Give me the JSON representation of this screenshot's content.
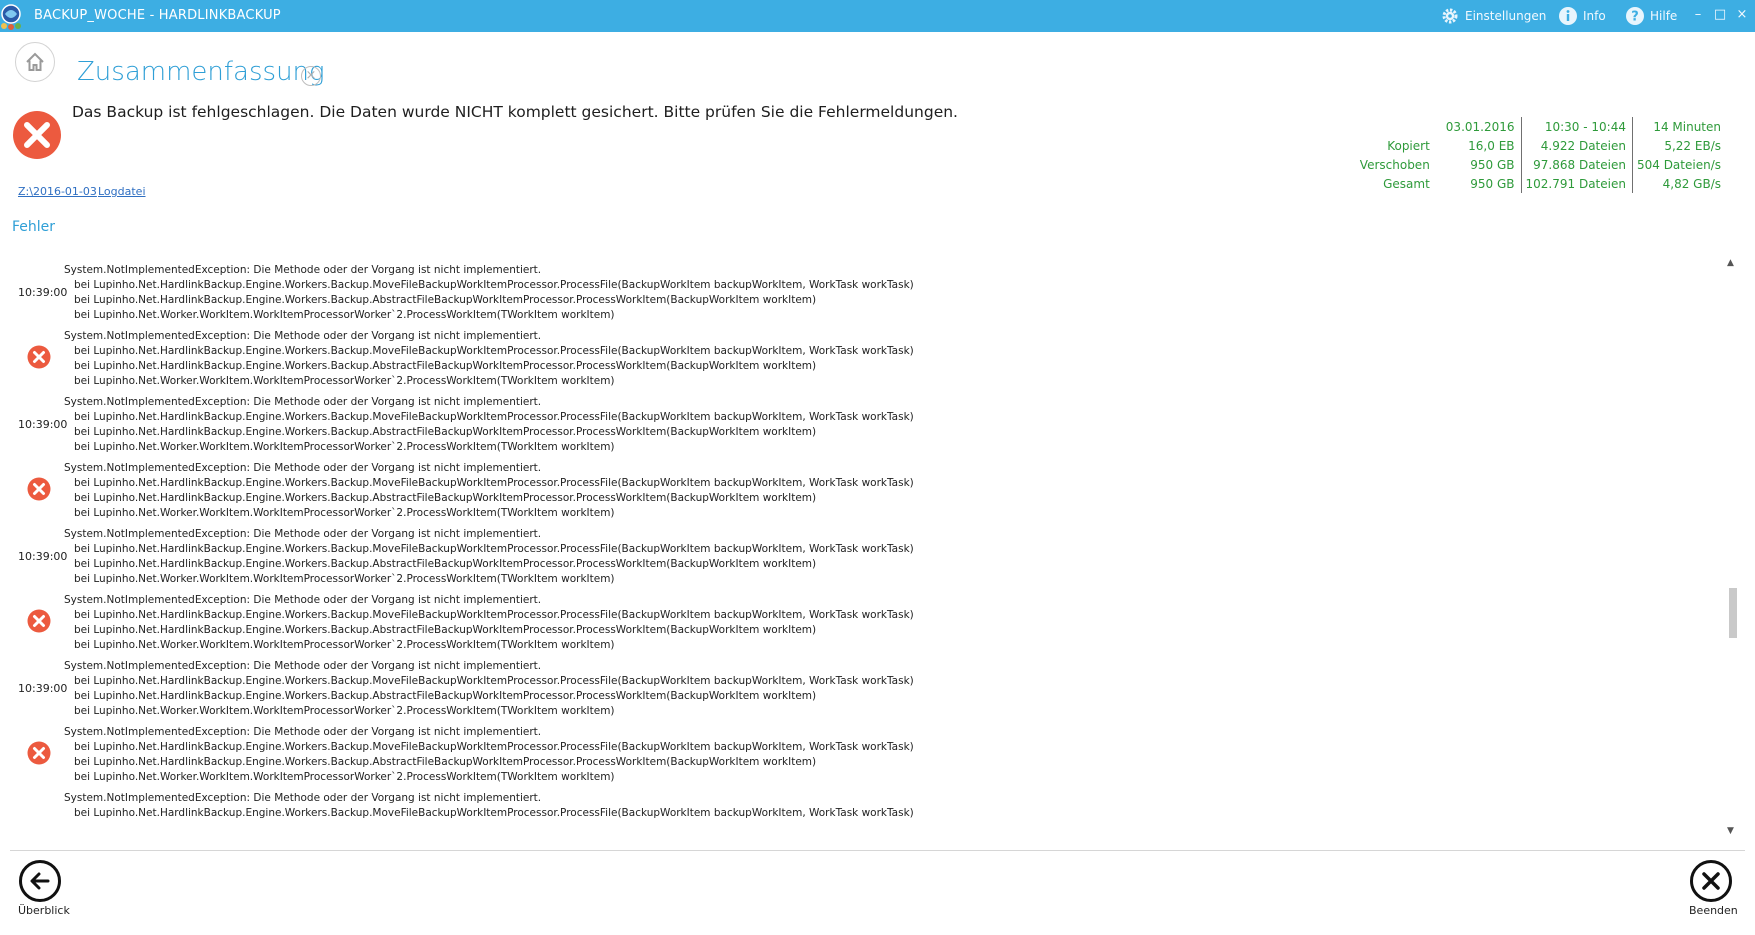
{
  "window": {
    "title": "BACKUP_WOCHE - HARDLINKBACKUP",
    "settings_label": "Einstellungen",
    "info_label": "Info",
    "help_label": "Hilfe",
    "minimize": "–",
    "maximize": "□",
    "close": "×"
  },
  "header": {
    "title": "Zusammenfassung",
    "close_glyph": "×",
    "status_message": "Das Backup ist fehlgeschlagen. Die Daten wurde NICHT komplett gesichert. Bitte prüfen Sie die Fehlermeldungen."
  },
  "stats": {
    "date": "03.01.2016",
    "time_range": "10:30 - 10:44",
    "duration": "14 Minuten",
    "rows": [
      {
        "label": "Kopiert",
        "size": "16,0 EB",
        "files": "4.922 Dateien",
        "rate": "5,22 EB/s"
      },
      {
        "label": "Verschoben",
        "size": "950 GB",
        "files": "97.868 Dateien",
        "rate": "504 Dateien/s"
      },
      {
        "label": "Gesamt",
        "size": "950 GB",
        "files": "102.791 Dateien",
        "rate": "4,82 GB/s"
      }
    ]
  },
  "links": {
    "path": "Z:\\2016-01-03",
    "logfile": "Logdatei"
  },
  "errors": {
    "section_label": "Fehler",
    "items": [
      {
        "time": "10:39:00",
        "l1": "System.NotImplementedException: Die Methode oder der Vorgang ist nicht implementiert.",
        "l2": "bei Lupinho.Net.HardlinkBackup.Engine.Workers.Backup.MoveFileBackupWorkItemProcessor.ProcessFile(BackupWorkItem backupWorkItem, WorkTask workTask)",
        "l3": "bei Lupinho.Net.HardlinkBackup.Engine.Workers.Backup.AbstractFileBackupWorkItemProcessor.ProcessWorkItem(BackupWorkItem workItem)",
        "l4": "bei Lupinho.Net.Worker.WorkItem.WorkItemProcessorWorker`2.ProcessWorkItem(TWorkItem workItem)"
      },
      {
        "time": "",
        "l1": "System.NotImplementedException: Die Methode oder der Vorgang ist nicht implementiert.",
        "l2": "bei Lupinho.Net.HardlinkBackup.Engine.Workers.Backup.MoveFileBackupWorkItemProcessor.ProcessFile(BackupWorkItem backupWorkItem, WorkTask workTask)",
        "l3": "bei Lupinho.Net.HardlinkBackup.Engine.Workers.Backup.AbstractFileBackupWorkItemProcessor.ProcessWorkItem(BackupWorkItem workItem)",
        "l4": "bei Lupinho.Net.Worker.WorkItem.WorkItemProcessorWorker`2.ProcessWorkItem(TWorkItem workItem)"
      },
      {
        "time": "10:39:00",
        "l1": "System.NotImplementedException: Die Methode oder der Vorgang ist nicht implementiert.",
        "l2": "bei Lupinho.Net.HardlinkBackup.Engine.Workers.Backup.MoveFileBackupWorkItemProcessor.ProcessFile(BackupWorkItem backupWorkItem, WorkTask workTask)",
        "l3": "bei Lupinho.Net.HardlinkBackup.Engine.Workers.Backup.AbstractFileBackupWorkItemProcessor.ProcessWorkItem(BackupWorkItem workItem)",
        "l4": "bei Lupinho.Net.Worker.WorkItem.WorkItemProcessorWorker`2.ProcessWorkItem(TWorkItem workItem)"
      },
      {
        "time": "",
        "l1": "System.NotImplementedException: Die Methode oder der Vorgang ist nicht implementiert.",
        "l2": "bei Lupinho.Net.HardlinkBackup.Engine.Workers.Backup.MoveFileBackupWorkItemProcessor.ProcessFile(BackupWorkItem backupWorkItem, WorkTask workTask)",
        "l3": "bei Lupinho.Net.HardlinkBackup.Engine.Workers.Backup.AbstractFileBackupWorkItemProcessor.ProcessWorkItem(BackupWorkItem workItem)",
        "l4": "bei Lupinho.Net.Worker.WorkItem.WorkItemProcessorWorker`2.ProcessWorkItem(TWorkItem workItem)"
      },
      {
        "time": "10:39:00",
        "l1": "System.NotImplementedException: Die Methode oder der Vorgang ist nicht implementiert.",
        "l2": "bei Lupinho.Net.HardlinkBackup.Engine.Workers.Backup.MoveFileBackupWorkItemProcessor.ProcessFile(BackupWorkItem backupWorkItem, WorkTask workTask)",
        "l3": "bei Lupinho.Net.HardlinkBackup.Engine.Workers.Backup.AbstractFileBackupWorkItemProcessor.ProcessWorkItem(BackupWorkItem workItem)",
        "l4": "bei Lupinho.Net.Worker.WorkItem.WorkItemProcessorWorker`2.ProcessWorkItem(TWorkItem workItem)"
      },
      {
        "time": "",
        "l1": "System.NotImplementedException: Die Methode oder der Vorgang ist nicht implementiert.",
        "l2": "bei Lupinho.Net.HardlinkBackup.Engine.Workers.Backup.MoveFileBackupWorkItemProcessor.ProcessFile(BackupWorkItem backupWorkItem, WorkTask workTask)",
        "l3": "bei Lupinho.Net.HardlinkBackup.Engine.Workers.Backup.AbstractFileBackupWorkItemProcessor.ProcessWorkItem(BackupWorkItem workItem)",
        "l4": "bei Lupinho.Net.Worker.WorkItem.WorkItemProcessorWorker`2.ProcessWorkItem(TWorkItem workItem)"
      },
      {
        "time": "10:39:00",
        "l1": "System.NotImplementedException: Die Methode oder der Vorgang ist nicht implementiert.",
        "l2": "bei Lupinho.Net.HardlinkBackup.Engine.Workers.Backup.MoveFileBackupWorkItemProcessor.ProcessFile(BackupWorkItem backupWorkItem, WorkTask workTask)",
        "l3": "bei Lupinho.Net.HardlinkBackup.Engine.Workers.Backup.AbstractFileBackupWorkItemProcessor.ProcessWorkItem(BackupWorkItem workItem)",
        "l4": "bei Lupinho.Net.Worker.WorkItem.WorkItemProcessorWorker`2.ProcessWorkItem(TWorkItem workItem)"
      },
      {
        "time": "",
        "l1": "System.NotImplementedException: Die Methode oder der Vorgang ist nicht implementiert.",
        "l2": "bei Lupinho.Net.HardlinkBackup.Engine.Workers.Backup.MoveFileBackupWorkItemProcessor.ProcessFile(BackupWorkItem backupWorkItem, WorkTask workTask)",
        "l3": "bei Lupinho.Net.HardlinkBackup.Engine.Workers.Backup.AbstractFileBackupWorkItemProcessor.ProcessWorkItem(BackupWorkItem workItem)",
        "l4": "bei Lupinho.Net.Worker.WorkItem.WorkItemProcessorWorker`2.ProcessWorkItem(TWorkItem workItem)"
      },
      {
        "time": "",
        "l1": "System.NotImplementedException: Die Methode oder der Vorgang ist nicht implementiert.",
        "l2": "bei Lupinho.Net.HardlinkBackup.Engine.Workers.Backup.MoveFileBackupWorkItemProcessor.ProcessFile(BackupWorkItem backupWorkItem, WorkTask workTask)",
        "l3": "",
        "l4": ""
      }
    ]
  },
  "footer": {
    "back_label": "Überblick",
    "exit_label": "Beenden"
  },
  "colors": {
    "titlebar": "#3daee3",
    "accent": "#2f9fd6",
    "error_red": "#ec5a3f",
    "stats_green": "#2e9a3a"
  }
}
